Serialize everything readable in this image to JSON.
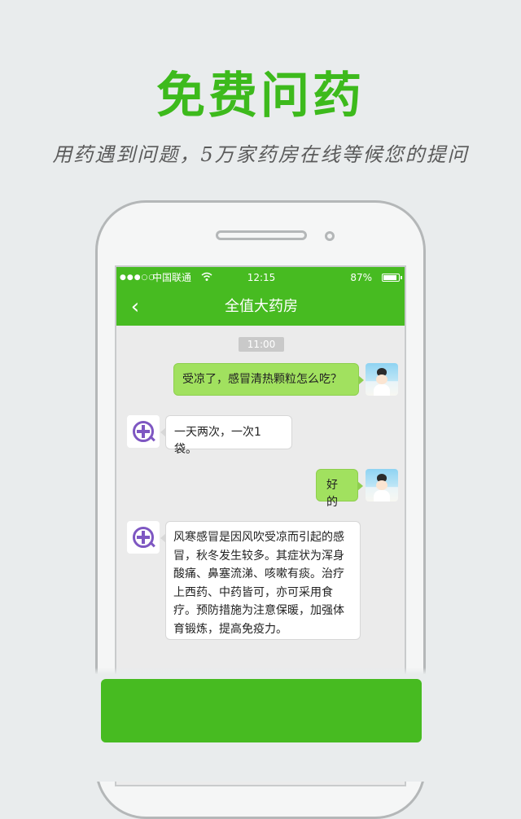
{
  "promo": {
    "headline": "免费问药",
    "subline": "用药遇到问题，5万家药房在线等候您的提问"
  },
  "status_bar": {
    "signal": "●●●○○",
    "carrier": "中国联通",
    "wifi_icon": "wifi-icon",
    "time": "12:15",
    "battery_percent": "87%",
    "battery_level": 0.87
  },
  "nav": {
    "back_icon": "chevron-left-icon",
    "back_glyph": "‹",
    "title": "全值大药房"
  },
  "chat": {
    "timestamp": "11:00",
    "messages": [
      {
        "sender": "user",
        "text": "受凉了，感冒清热颗粒怎么吃？"
      },
      {
        "sender": "pharmacy",
        "text": "一天两次，一次1袋。"
      },
      {
        "sender": "user",
        "text": "好的"
      },
      {
        "sender": "pharmacy",
        "text": "风寒感冒是因风吹受凉而引起的感冒，秋冬发生较多。其症状为浑身酸痛、鼻塞流涕、咳嗽有痰。治疗上西药、中药皆可，亦可采用食疗。预防措施为注意保暖，加强体育锻炼，提高免疫力。"
      }
    ]
  },
  "colors": {
    "brand_green": "#47bb21",
    "headline_green": "#3dba1c",
    "outgoing_bubble": "#a1e15f",
    "pharmacy_icon": "#7e57c2"
  }
}
